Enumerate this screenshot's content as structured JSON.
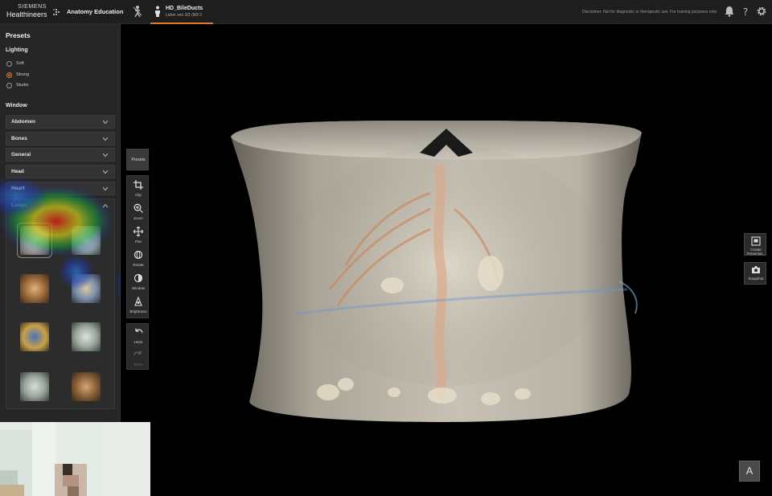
{
  "header": {
    "brand_line1": "SIEMENS",
    "brand_line2": "Healthineers",
    "app_name": "Anatomy Education",
    "case_title": "HD_BileDucts",
    "case_subtitle": "Leber ven 3/2 (90f 3",
    "disclaimer": "Disclaimer: Not for diagnostic or therapeutic use. For training purposes only.",
    "icons": [
      "anatomy-figure-icon",
      "person-icon",
      "bell-icon",
      "help-icon",
      "gear-icon"
    ],
    "accent_color": "#e0772a"
  },
  "presets_panel": {
    "title": "Presets",
    "lighting": {
      "label": "Lighting",
      "options": [
        {
          "label": "Soft",
          "selected": false
        },
        {
          "label": "Strong",
          "selected": true
        },
        {
          "label": "Studio",
          "selected": false
        }
      ]
    },
    "window": {
      "label": "Window",
      "groups": [
        {
          "label": "Abdomen",
          "expanded": false
        },
        {
          "label": "Bones",
          "expanded": false
        },
        {
          "label": "General",
          "expanded": false
        },
        {
          "label": "Head",
          "expanded": false
        },
        {
          "label": "Heart",
          "expanded": false
        },
        {
          "label": "Lungs",
          "expanded": true
        }
      ]
    }
  },
  "toolbar": {
    "presets_label": "Presets",
    "tools": [
      {
        "label": "Clip",
        "icon": "crop-icon",
        "enabled": true
      },
      {
        "label": "Zoom",
        "icon": "zoom-icon",
        "enabled": true
      },
      {
        "label": "Pan",
        "icon": "pan-icon",
        "enabled": true
      },
      {
        "label": "Rotate",
        "icon": "rotate-icon",
        "enabled": true
      },
      {
        "label": "Window",
        "icon": "window-icon",
        "enabled": true
      },
      {
        "label": "Brightness",
        "icon": "brightness-icon",
        "enabled": true
      }
    ],
    "history": [
      {
        "label": "Undo",
        "icon": "undo-icon",
        "enabled": true
      },
      {
        "label": "Redo",
        "icon": "redo-icon",
        "enabled": false
      }
    ]
  },
  "right_actions": {
    "create_presentation": "Create Presentat...",
    "snapshot": "Snapshot"
  },
  "corner_button": "A"
}
